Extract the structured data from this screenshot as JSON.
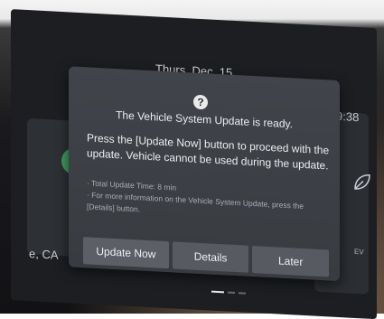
{
  "background": {
    "location": "e, CA",
    "time": "9:38",
    "ev_label": "EV"
  },
  "header": {
    "date": "Thurs, Dec. 15"
  },
  "dialog": {
    "icon": "question-icon",
    "title": "The Vehicle System Update is ready.",
    "body": "Press the [Update Now] button to proceed with the update. Vehicle cannot be used during the update.",
    "notes": [
      "· Total Update Time: 8 min",
      "· For more information on the Vehicle System Update, press the [Details] button."
    ],
    "buttons": {
      "update_now": "Update Now",
      "details": "Details",
      "later": "Later"
    }
  },
  "pager": {
    "pages": 3,
    "active": 1
  },
  "colors": {
    "dialog_bg": "#3c3f44",
    "button_bg": "#575b61",
    "nav_green": "#3e9a5e"
  }
}
